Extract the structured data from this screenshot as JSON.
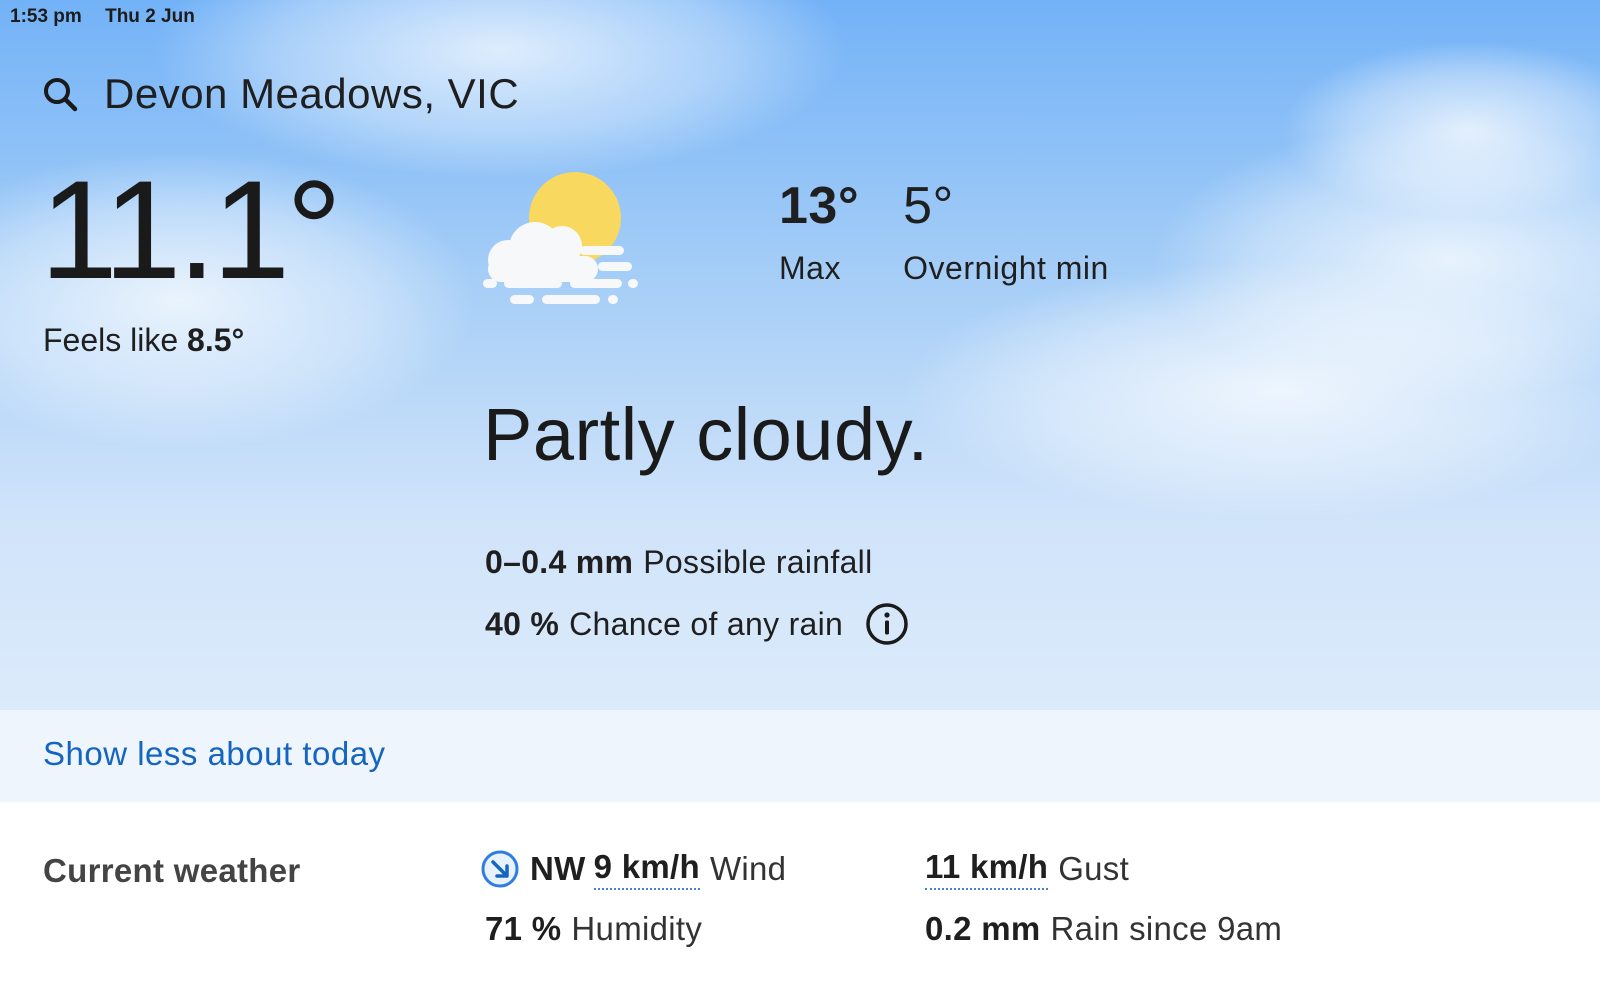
{
  "status_bar": {
    "time": "1:53 pm",
    "date": "Thu 2 Jun"
  },
  "location": "Devon Meadows, VIC",
  "current": {
    "temp": "11.1°",
    "feels_like_label": "Feels like",
    "feels_like_value": "8.5°"
  },
  "forecast": {
    "max_value": "13°",
    "max_label": "Max",
    "min_value": "5°",
    "min_label": "Overnight min",
    "summary": "Partly cloudy.",
    "rainfall_value": "0–0.4 mm",
    "rainfall_label": "Possible rainfall",
    "rain_chance_value": "40 %",
    "rain_chance_label": "Chance of any rain"
  },
  "show_less_link": "Show less about today",
  "current_weather": {
    "heading": "Current weather",
    "wind_direction": "NW",
    "wind_speed": "9 km/h",
    "wind_label": "Wind",
    "gust_value": "11 km/h",
    "gust_label": "Gust",
    "humidity_value": "71 %",
    "humidity_label": "Humidity",
    "rain_since_value": "0.2 mm",
    "rain_since_label": "Rain since 9am"
  },
  "icons": {
    "search": "search-icon",
    "weather": "partly-cloudy-fog-icon",
    "info": "info-icon",
    "wind": "wind-direction-arrow-icon"
  },
  "colors": {
    "link": "#1565c0",
    "sky_top": "#73b2f7",
    "sky_bottom": "#dcebfb"
  }
}
